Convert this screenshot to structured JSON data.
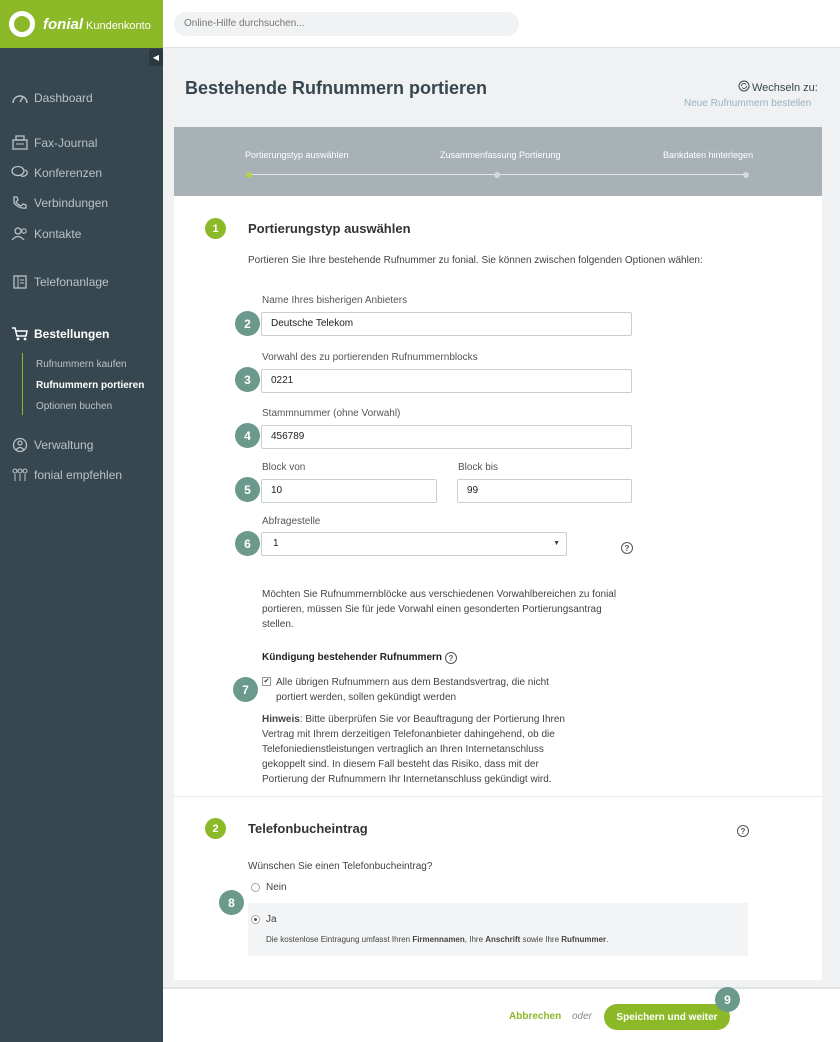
{
  "brand": {
    "name": "fonial",
    "suffix": "Kundenkonto"
  },
  "search": {
    "placeholder": "Online-Hilfe durchsuchen..."
  },
  "sidebar": {
    "items": [
      {
        "label": "Dashboard",
        "icon": "gauge-icon"
      },
      {
        "label": "Fax-Journal",
        "icon": "fax-icon"
      },
      {
        "label": "Konferenzen",
        "icon": "chat-icon"
      },
      {
        "label": "Verbindungen",
        "icon": "phone-icon"
      },
      {
        "label": "Kontakte",
        "icon": "contacts-icon"
      },
      {
        "label": "Telefonanlage",
        "icon": "pbx-icon"
      },
      {
        "label": "Bestellungen",
        "icon": "cart-icon"
      },
      {
        "label": "Verwaltung",
        "icon": "admin-icon"
      },
      {
        "label": "fonial empfehlen",
        "icon": "recommend-icon"
      }
    ],
    "subitems": [
      {
        "label": "Rufnummern kaufen"
      },
      {
        "label": "Rufnummern portieren"
      },
      {
        "label": "Optionen buchen"
      }
    ]
  },
  "page": {
    "title": "Bestehende Rufnummern portieren",
    "switch_label": "Wechseln zu:",
    "switch_link": "Neue Rufnummern bestellen"
  },
  "stepper": {
    "steps": [
      {
        "label": "Portierungstyp auswählen"
      },
      {
        "label": "Zusammenfassung Portierung"
      },
      {
        "label": "Bankdaten hinterlegen"
      }
    ]
  },
  "section1": {
    "number": "1",
    "title": "Portierungstyp auswählen",
    "intro": "Portieren Sie Ihre bestehende Rufnummer zu fonial. Sie können zwischen folgenden Optionen wählen:",
    "provider_label": "Name Ihres bisherigen Anbieters",
    "provider_value": "Deutsche Telekom",
    "prefix_label": "Vorwahl des zu portierenden Rufnummernblocks",
    "prefix_value": "0221",
    "base_label": "Stammnummer (ohne Vorwahl)",
    "base_value": "456789",
    "block_from_label": "Block von",
    "block_from_value": "10",
    "block_to_label": "Block bis",
    "block_to_value": "99",
    "query_label": "Abfragestelle",
    "query_value": "1",
    "info": "Möchten Sie Rufnummernblöcke aus verschiedenen Vorwahlbereichen zu fonial portieren, müssen Sie für jede Vorwahl einen gesonderten Portierungsantrag stellen.",
    "termination_title": "Kündigung bestehender Rufnummern",
    "termination_check": "Alle übrigen Rufnummern aus dem Bestandsvertrag, die nicht portiert werden, sollen gekündigt werden",
    "hint_bold": "Hinweis",
    "hint_text": ": Bitte überprüfen Sie vor Beauftragung der Portierung Ihren Vertrag mit Ihrem derzeitigen Telefonanbieter dahingehend, ob die Telefoniedienstleistungen vertraglich an Ihren Internetanschluss gekoppelt sind. In diesem Fall besteht das Risiko, dass mit der Portierung der Rufnummern Ihr Internetanschluss gekündigt wird."
  },
  "section2": {
    "number": "2",
    "title": "Telefonbucheintrag",
    "question": "Wünschen Sie einen Telefonbucheintrag?",
    "option_no": "Nein",
    "option_yes": "Ja",
    "note_pre": "Die kostenlose Eintragung umfasst Ihren ",
    "note_b1": "Firmennamen",
    "note_mid1": ", Ihre ",
    "note_b2": "Anschrift",
    "note_mid2": " sowie Ihre ",
    "note_b3": "Rufnummer",
    "note_end": "."
  },
  "markers": [
    "2",
    "3",
    "4",
    "5",
    "6",
    "7",
    "8",
    "9"
  ],
  "footer": {
    "cancel": "Abbrechen",
    "or": "oder",
    "save": "Speichern und weiter"
  }
}
